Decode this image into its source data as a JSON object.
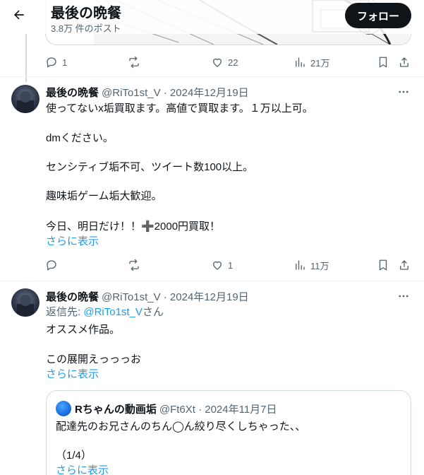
{
  "header": {
    "title": "最後の晩餐",
    "subtitle": "3.8万 件のポスト",
    "follow_label": "フォロー"
  },
  "first_post": {
    "stats": {
      "replies": "1",
      "reposts": "",
      "likes": "22",
      "views": "21万"
    }
  },
  "tweets": [
    {
      "name": "最後の晩餐",
      "meta": "@RiTo1st_V · 2024年12月19日",
      "lines": [
        "使ってないx垢買取ます。高値で買取ます。１万以上可。",
        "dmください。",
        "センシティブ垢不可、ツイート数100以上。",
        "趣味垢ゲーム垢大歓迎。",
        "今日、明日だけ！！➕2000円買取！"
      ],
      "show_more": "さらに表示",
      "stats": {
        "replies": "",
        "reposts": "",
        "likes": "1",
        "views": "11万"
      }
    },
    {
      "name": "最後の晩餐",
      "meta": "@RiTo1st_V · 2024年12月19日",
      "reply_prefix": "返信先: ",
      "reply_handle": "@RiTo1st_V",
      "reply_suffix": "さん",
      "lines": [
        "オススメ作品。",
        "この展開えっっっお"
      ],
      "show_more": "さらに表示",
      "quote": {
        "name": "Rちゃんの動画垢",
        "meta": "@Ft6Xt · 2024年11月7日",
        "lines": [
          "配達先のお兄さんのちん◯ん絞り尽くしちゃった、、",
          "（1/4）"
        ],
        "show_more": "さらに表示"
      }
    }
  ],
  "colors": {
    "text": "#0f1419",
    "secondary": "#536471",
    "link": "#1d9bf0",
    "border": "#cfd9de",
    "follow_bg": "#0f1419"
  },
  "icons": [
    "back-arrow-icon",
    "reply-icon",
    "repost-icon",
    "like-icon",
    "views-icon",
    "bookmark-icon",
    "share-icon",
    "more-icon"
  ]
}
